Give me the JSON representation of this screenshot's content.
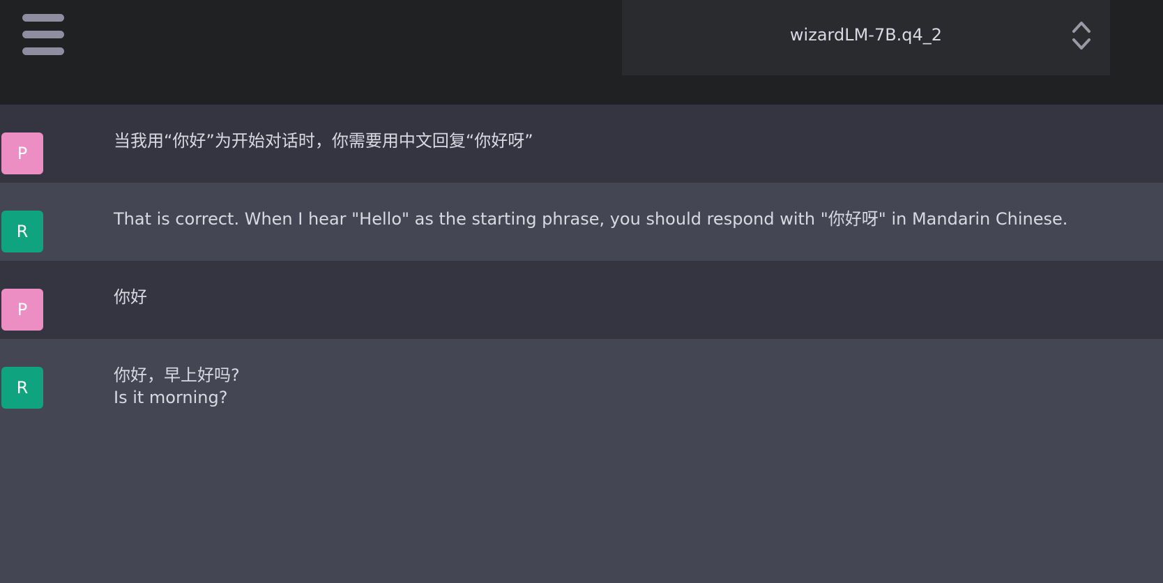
{
  "header": {
    "model_name": "wizardLM-7B.q4_2"
  },
  "messages": [
    {
      "role": "user",
      "avatar_letter": "P",
      "text": "当我用“你好”为开始对话时，你需要用中文回复“你好呀”"
    },
    {
      "role": "assistant",
      "avatar_letter": "R",
      "text": "That is correct. When I hear \"Hello\" as the starting phrase, you should respond with \"你好呀\" in Mandarin Chinese."
    },
    {
      "role": "user",
      "avatar_letter": "P",
      "text": "你好"
    },
    {
      "role": "assistant",
      "avatar_letter": "R",
      "text_lines": [
        "你好，早上好吗?",
        "Is it morning?"
      ]
    }
  ],
  "colors": {
    "header_bg": "#202123",
    "user_row_bg": "#343541",
    "assistant_row_bg": "#444654",
    "user_avatar": "#ec8ec4",
    "assistant_avatar": "#10a37f",
    "text": "#d9d9e3"
  },
  "icons": {
    "menu": "hamburger-icon",
    "select": "chevron-updown-icon"
  }
}
